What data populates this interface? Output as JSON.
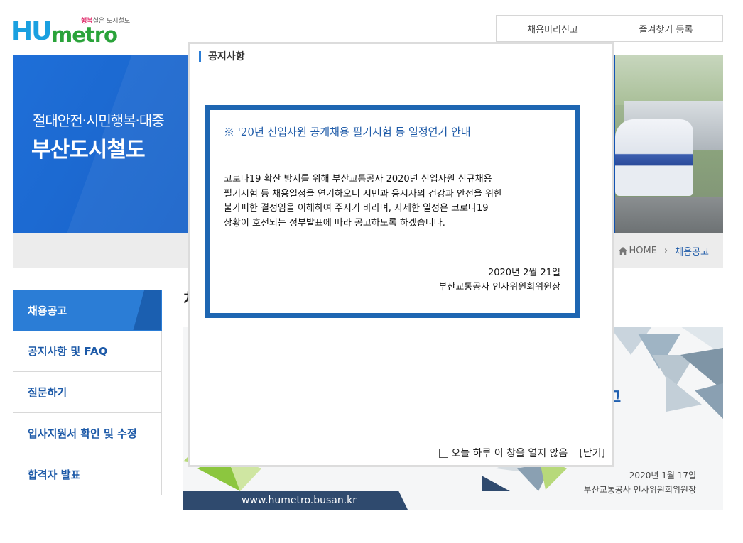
{
  "header": {
    "logo": {
      "hu": "HU",
      "metro": "metro",
      "tagline_strong": "행복",
      "tagline_rest": "실은 도시철도"
    },
    "links": [
      "채용비리신고",
      "즐겨찾기 등록"
    ]
  },
  "visual": {
    "slogan": "절대안전·시민행복·대중",
    "company": "부산도시철도"
  },
  "location": {
    "home": "HOME",
    "current": "채용공고"
  },
  "lnb": {
    "items": [
      "채용공고",
      "공지사항 및 FAQ",
      "질문하기",
      "입사지원서 확인 및 수정",
      "합격자 발표"
    ]
  },
  "content": {
    "title_fragment": "처",
    "banner": {
      "hint": "고",
      "date": "2020년 1월 17일",
      "org": "부산교통공사 인사위원회위원장",
      "url": "www.humetro.busan.kr"
    }
  },
  "popup": {
    "title": "공지사항",
    "heading": "※ '20년 신입사원 공개채용 필기시험 등 일정연기 안내",
    "body_lines": [
      "코로나19 확산 방지를 위해 부산교통공사 2020년 신입사원 신규채용",
      "필기시험 등 채용일정을 연기하오니 시민과 응시자의 건강과 안전을 위한",
      "불가피한 결정임을 이해하여 주시기 바라며, 자세한 일정은 코로나19",
      "상황이 호전되는 정부발표에 따라 공고하도록 하겠습니다."
    ],
    "date": "2020년 2월 21일",
    "org": "부산교통공사 인사위원회위원장",
    "dont_show_label": "오늘 하루 이 창을 열지 않음",
    "close_label": "[닫기]"
  },
  "colors": {
    "brand_blue": "#1e66b2",
    "lnb_active": "#2b7dd6",
    "logo_blue": "#1aa0e0",
    "logo_green": "#2aa33a"
  }
}
